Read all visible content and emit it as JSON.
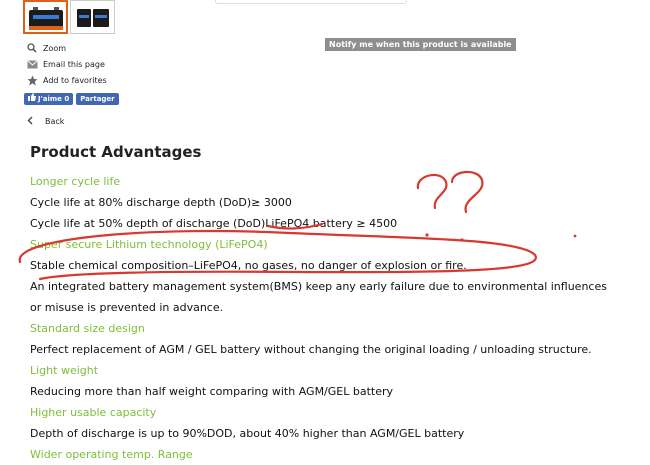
{
  "gallery": {
    "thumbnails": [
      "battery-product-1",
      "battery-product-2"
    ]
  },
  "sidebar": {
    "links": [
      {
        "label": "Zoom",
        "icon": "search-icon"
      },
      {
        "label": "Email this page",
        "icon": "email-icon"
      },
      {
        "label": "Add to favorites",
        "icon": "star-icon"
      }
    ],
    "like_label": "J'aime 0",
    "share_label": "Partager"
  },
  "notify_label": "Notify me when this product is available",
  "back_label": "Back",
  "content": {
    "heading": "Product Advantages",
    "lines": [
      {
        "text": "Longer cycle life",
        "style": "green"
      },
      {
        "text": "Cycle life at 80% discharge depth (DoD)≥ 3000",
        "style": "black"
      },
      {
        "text": "Cycle life at 50% depth of discharge (DoD)LiFePO4 battery ≥ 4500",
        "style": "black"
      },
      {
        "text": "Super secure Lithium technology (LiFePO4)",
        "style": "green"
      },
      {
        "text": "Stable chemical composition–LiFePO4, no gases, no danger of explosion or fire.",
        "style": "black"
      },
      {
        "text": "An integrated battery management system(BMS) keep any early failure due to environmental influences",
        "style": "black"
      },
      {
        "text": "or misuse is prevented in advance.",
        "style": "black"
      },
      {
        "text": "Standard size design",
        "style": "green"
      },
      {
        "text": "Perfect replacement of AGM / GEL battery without changing the original loading / unloading structure.",
        "style": "black"
      },
      {
        "text": "Light weight",
        "style": "green"
      },
      {
        "text": "Reducing more than half weight comparing with AGM/GEL battery",
        "style": "black"
      },
      {
        "text": "Higher usable capacity",
        "style": "green"
      },
      {
        "text": "Depth of discharge is up to 90%DOD, about 40% higher than AGM/GEL battery",
        "style": "black"
      },
      {
        "text": "Wider operating temp. Range",
        "style": "green"
      }
    ]
  },
  "colors": {
    "accent_green": "#7cbf3a",
    "facebook_blue": "#4267b2",
    "annotation_red": "#d8382e",
    "notify_gray": "#8e8e8e"
  }
}
